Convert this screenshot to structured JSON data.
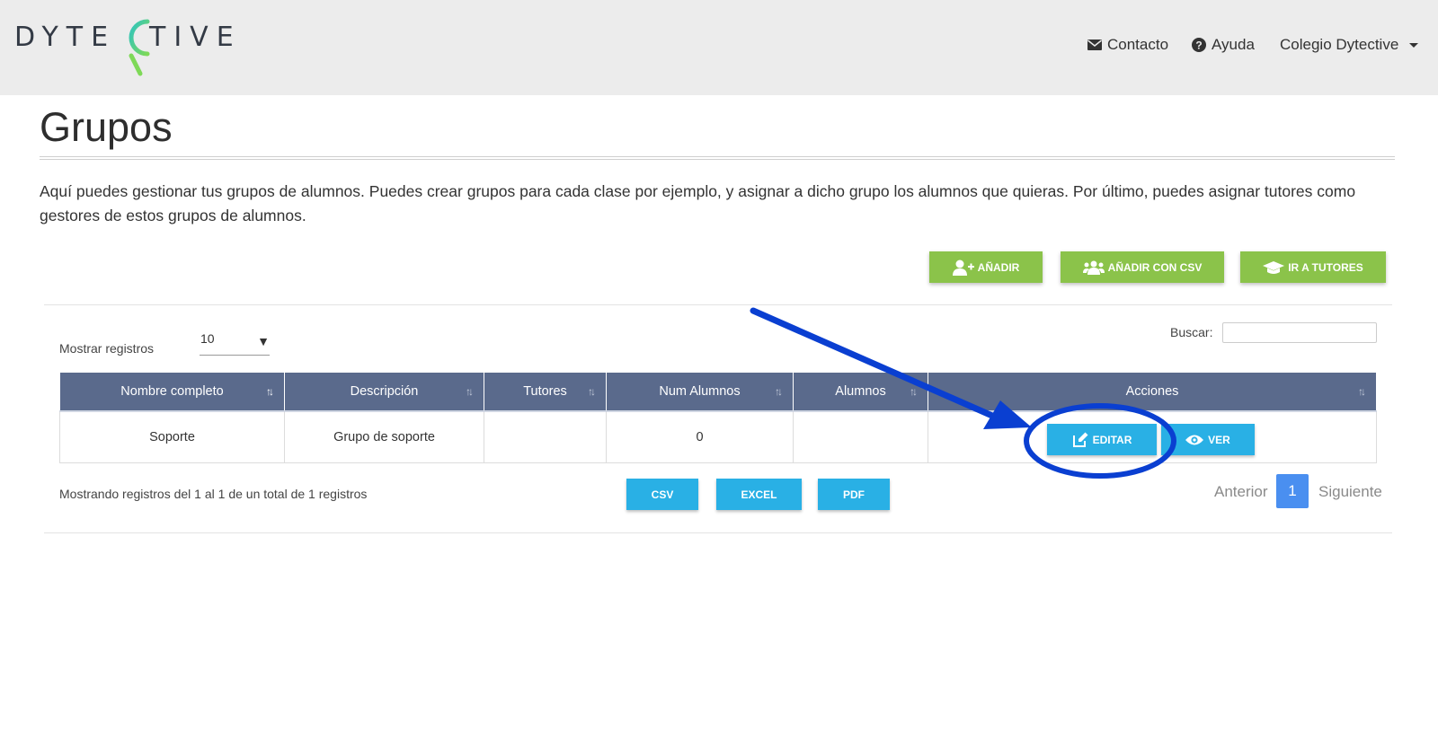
{
  "header": {
    "logo_text": "DYTECTIVE",
    "logo_left": "DYTE",
    "logo_right": "TIVE",
    "nav": {
      "contact": "Contacto",
      "help": "Ayuda",
      "account": "Colegio Dytective"
    }
  },
  "page": {
    "title": "Grupos",
    "intro": "Aquí puedes gestionar tus grupos de alumnos. Puedes crear grupos para cada clase por ejemplo, y asignar a dicho grupo los alumnos que quieras. Por último, puedes asignar tutores como gestores de estos grupos de alumnos."
  },
  "actions": {
    "add": "AÑADIR",
    "add_csv": "AÑADIR CON CSV",
    "tutors": "IR A TUTORES"
  },
  "table_controls": {
    "show_label": "Mostrar registros",
    "page_size": "10",
    "search_label": "Buscar:",
    "search_value": ""
  },
  "table": {
    "columns": [
      "Nombre completo",
      "Descripción",
      "Tutores",
      "Num Alumnos",
      "Alumnos",
      "Acciones"
    ],
    "rows": [
      {
        "name": "Soporte",
        "description": "Grupo de soporte",
        "tutors": "",
        "num_students": "0",
        "students": ""
      }
    ],
    "row_actions": {
      "edit": "EDITAR",
      "view": "VER"
    }
  },
  "footer": {
    "info": "Mostrando registros del 1 al 1 de un total de 1 registros",
    "export": {
      "csv": "CSV",
      "excel": "EXCEL",
      "pdf": "PDF"
    },
    "pagination": {
      "prev": "Anterior",
      "current": "1",
      "next": "Siguiente"
    }
  },
  "colors": {
    "header_bg": "#ececec",
    "green_button": "#8bc34a",
    "blue_button": "#29b0e5",
    "table_header": "#5a6a8c",
    "pagination_active": "#4a8ff0",
    "annotation": "#0a3fd1",
    "logo_accent_teal": "#2ec4c0",
    "logo_accent_green": "#7ed957"
  },
  "icons": [
    "envelope-icon",
    "question-circle-icon",
    "user-plus-icon",
    "users-icon",
    "graduation-cap-icon",
    "edit-icon",
    "eye-icon",
    "sort-icon",
    "caret-down-icon"
  ]
}
